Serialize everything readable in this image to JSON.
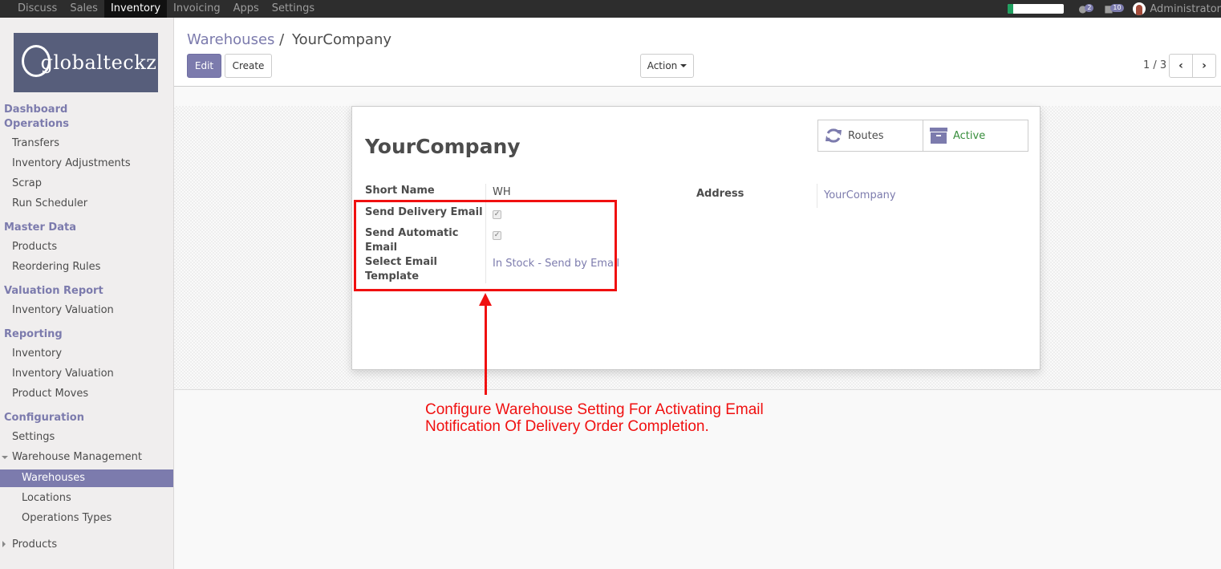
{
  "topbar": {
    "menu": [
      "Discuss",
      "Sales",
      "Inventory",
      "Invoicing",
      "Apps",
      "Settings"
    ],
    "active_menu": "Inventory",
    "progress_fraction": 0.1,
    "chat_badge": "2",
    "messages_badge": "10",
    "user": "Administrator"
  },
  "sidebar": {
    "logo_text": "globalteckz",
    "sections": {
      "dashboard": "Dashboard",
      "operations": "Operations",
      "transfers": "Transfers",
      "inventory_adjustments": "Inventory Adjustments",
      "scrap": "Scrap",
      "run_scheduler": "Run Scheduler",
      "master_data": "Master Data",
      "products": "Products",
      "reordering_rules": "Reordering Rules",
      "valuation_report": "Valuation Report",
      "inventory_valuation": "Inventory Valuation",
      "reporting": "Reporting",
      "inventory": "Inventory",
      "inventory_valuation_2": "Inventory Valuation",
      "product_moves": "Product Moves",
      "configuration": "Configuration",
      "settings": "Settings",
      "warehouse_management": "Warehouse Management",
      "warehouses": "Warehouses",
      "locations": "Locations",
      "operations_types": "Operations Types",
      "products_2": "Products"
    }
  },
  "control_panel": {
    "breadcrumb_parent": "Warehouses",
    "breadcrumb_sep": "/",
    "breadcrumb_current": "YourCompany",
    "edit_label": "Edit",
    "create_label": "Create",
    "action_label": "Action",
    "pager": "1 / 3"
  },
  "form": {
    "title": "YourCompany",
    "routes_label": "Routes",
    "active_label": "Active",
    "short_name_label": "Short Name",
    "short_name_value": "WH",
    "send_delivery_label": "Send Delivery Email",
    "send_auto_label_1": "Send Automatic",
    "send_auto_label_2": "Email",
    "template_label_1": "Select Email",
    "template_label_2": "Template",
    "template_value": "In Stock - Send by Email",
    "address_label": "Address",
    "address_value": "YourCompany"
  },
  "annotation": {
    "line1": "Configure Warehouse Setting For Activating Email",
    "line2": "Notification Of Delivery Order Completion."
  },
  "colors": {
    "brand": "#7c7bad",
    "topbar": "#2d2d2d",
    "annotation": "#f01010",
    "active_state": "#388e3c"
  }
}
